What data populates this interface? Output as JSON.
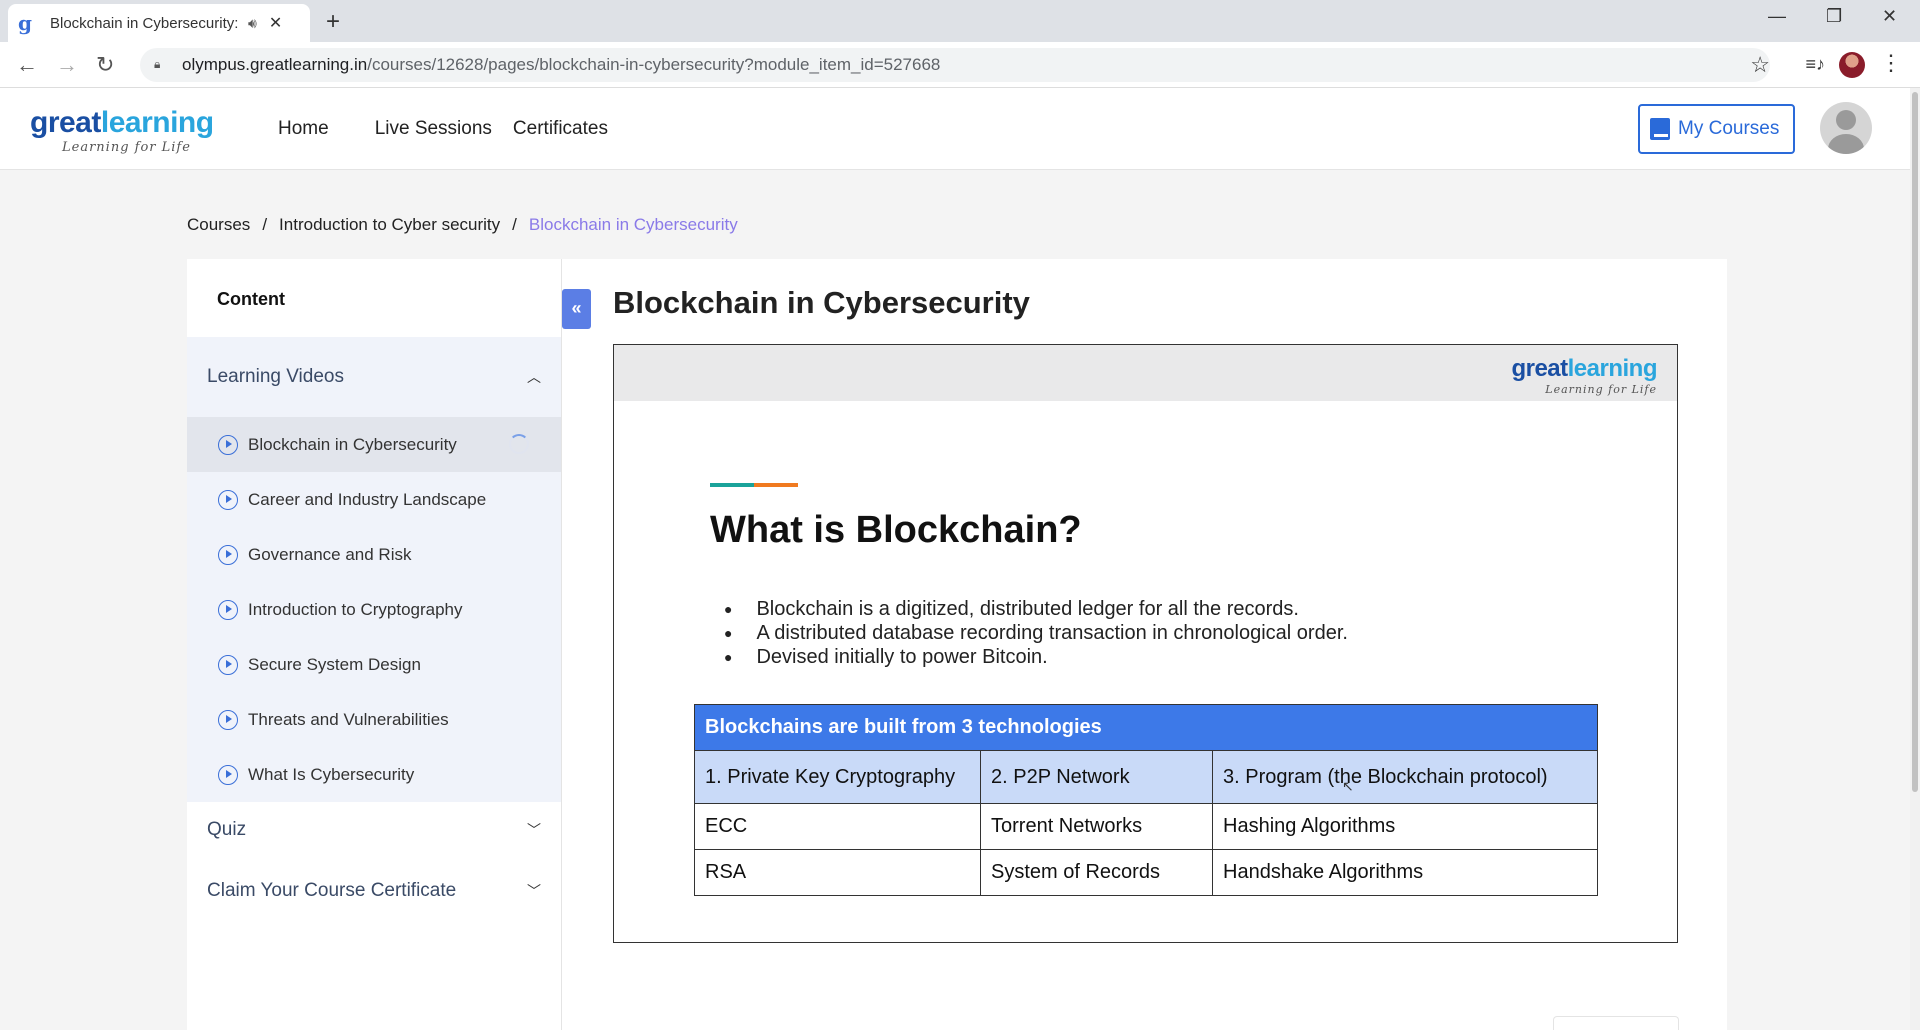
{
  "browser": {
    "tab_title": "Blockchain in Cybersecurity: ",
    "url_host": "olympus.greatlearning.in",
    "url_path": "/courses/12628/pages/blockchain-in-cybersecurity?module_item_id=527668"
  },
  "site": {
    "logo_main": "great",
    "logo_main_accent": "learning",
    "logo_sub": "Learning for Life",
    "nav": [
      "Home",
      "Live Sessions",
      "Certificates"
    ],
    "my_courses_label": "My Courses"
  },
  "breadcrumb": [
    "Courses",
    "Introduction to Cyber security",
    "Blockchain in Cybersecurity"
  ],
  "sidebar": {
    "heading": "Content",
    "sections": [
      {
        "label": "Learning Videos"
      },
      {
        "label": "Quiz"
      },
      {
        "label": "Claim Your Course Certificate"
      }
    ],
    "videos": [
      "Blockchain in Cybersecurity",
      "Career and Industry Landscape",
      "Governance and Risk",
      "Introduction to Cryptography",
      "Secure System Design",
      "Threats and Vulnerabilities",
      "What Is Cybersecurity"
    ]
  },
  "main": {
    "title": "Blockchain in Cybersecurity",
    "slide": {
      "title": "What is Blockchain?",
      "bullets": [
        "Blockchain is a digitized, distributed ledger for all the records.",
        "A distributed database recording transaction in chronological order.",
        "Devised initially to power Bitcoin."
      ],
      "table_header": "Blockchains are built from 3 technologies",
      "columns": [
        "1. Private Key Cryptography",
        "2. P2P Network",
        "3. Program (the Blockchain protocol)"
      ],
      "rows": [
        [
          "ECC",
          "Torrent Networks",
          "Hashing Algorithms"
        ],
        [
          "RSA",
          "System of Records",
          "Handshake Algorithms"
        ]
      ]
    }
  },
  "colors": {
    "accent_blue": "#2a6ad9",
    "breadcrumb_current": "#8a7ae8",
    "table_header": "#3d79e8",
    "table_subheader": "#c9daf8"
  }
}
